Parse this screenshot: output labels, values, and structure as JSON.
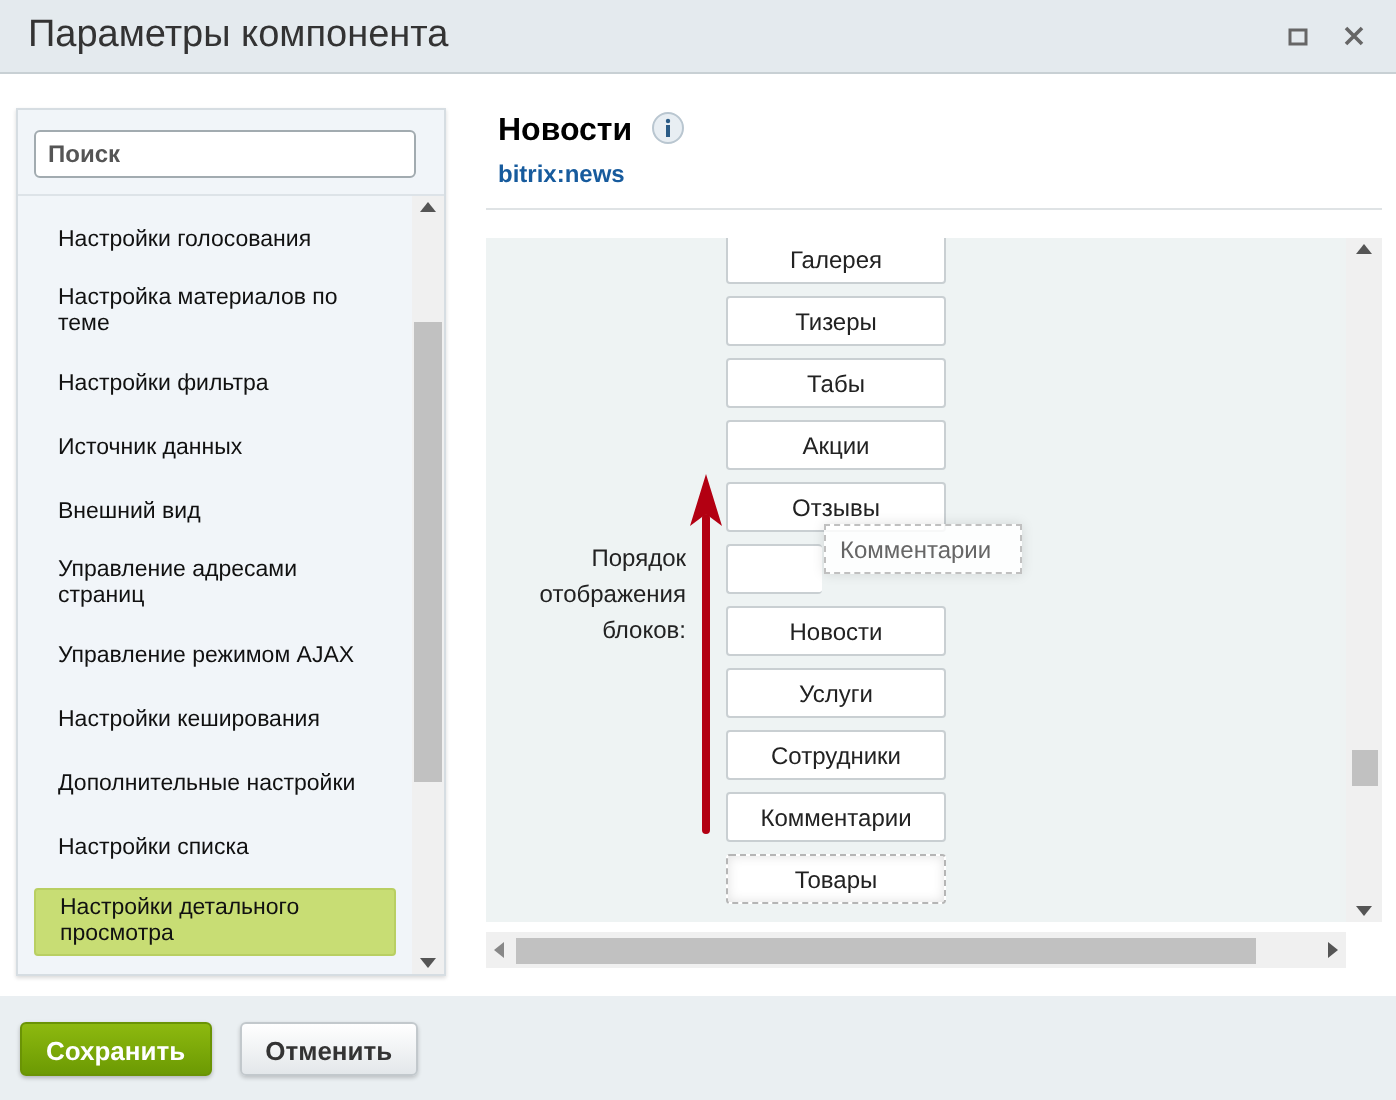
{
  "window": {
    "title": "Параметры компонента",
    "buttons": [
      {
        "kind": "maximize"
      },
      {
        "kind": "close"
      }
    ]
  },
  "sidebar": {
    "search": {
      "placeholder": "Поиск"
    },
    "items": [
      {
        "label": "Настройки голосования",
        "selected": false
      },
      {
        "label": "Настройка материалов по теме",
        "selected": false
      },
      {
        "label": "Настройки фильтра",
        "selected": false
      },
      {
        "label": "Источник данных",
        "selected": false
      },
      {
        "label": "Внешний вид",
        "selected": false
      },
      {
        "label": "Управление адресами страниц",
        "selected": false
      },
      {
        "label": "Управление режимом AJAX",
        "selected": false
      },
      {
        "label": "Настройки кеширования",
        "selected": false
      },
      {
        "label": "Дополнительные настройки",
        "selected": false
      },
      {
        "label": "Настройки списка",
        "selected": false
      },
      {
        "label": "Настройки детального просмотра",
        "selected": true
      }
    ]
  },
  "component": {
    "title": "Новости",
    "code": "bitrix:news"
  },
  "setting": {
    "label": "Порядок отображения блоков:",
    "blocks": [
      {
        "label": "Галерея",
        "kind": "normal"
      },
      {
        "label": "Тизеры",
        "kind": "normal"
      },
      {
        "label": "Табы",
        "kind": "normal"
      },
      {
        "label": "Акции",
        "kind": "normal"
      },
      {
        "label": "Отзывы",
        "kind": "normal"
      },
      {
        "kind": "covered"
      },
      {
        "label": "Новости",
        "kind": "normal"
      },
      {
        "label": "Услуги",
        "kind": "normal"
      },
      {
        "label": "Сотрудники",
        "kind": "normal"
      },
      {
        "label": "Комментарии",
        "kind": "normal"
      },
      {
        "label": "Товары",
        "kind": "dashed"
      }
    ],
    "dragged_block": {
      "label": "Комментарии"
    }
  },
  "footer": {
    "buttons": [
      {
        "label": "Сохранить",
        "kind": "primary"
      },
      {
        "label": "Отменить",
        "kind": "secondary"
      }
    ]
  }
}
